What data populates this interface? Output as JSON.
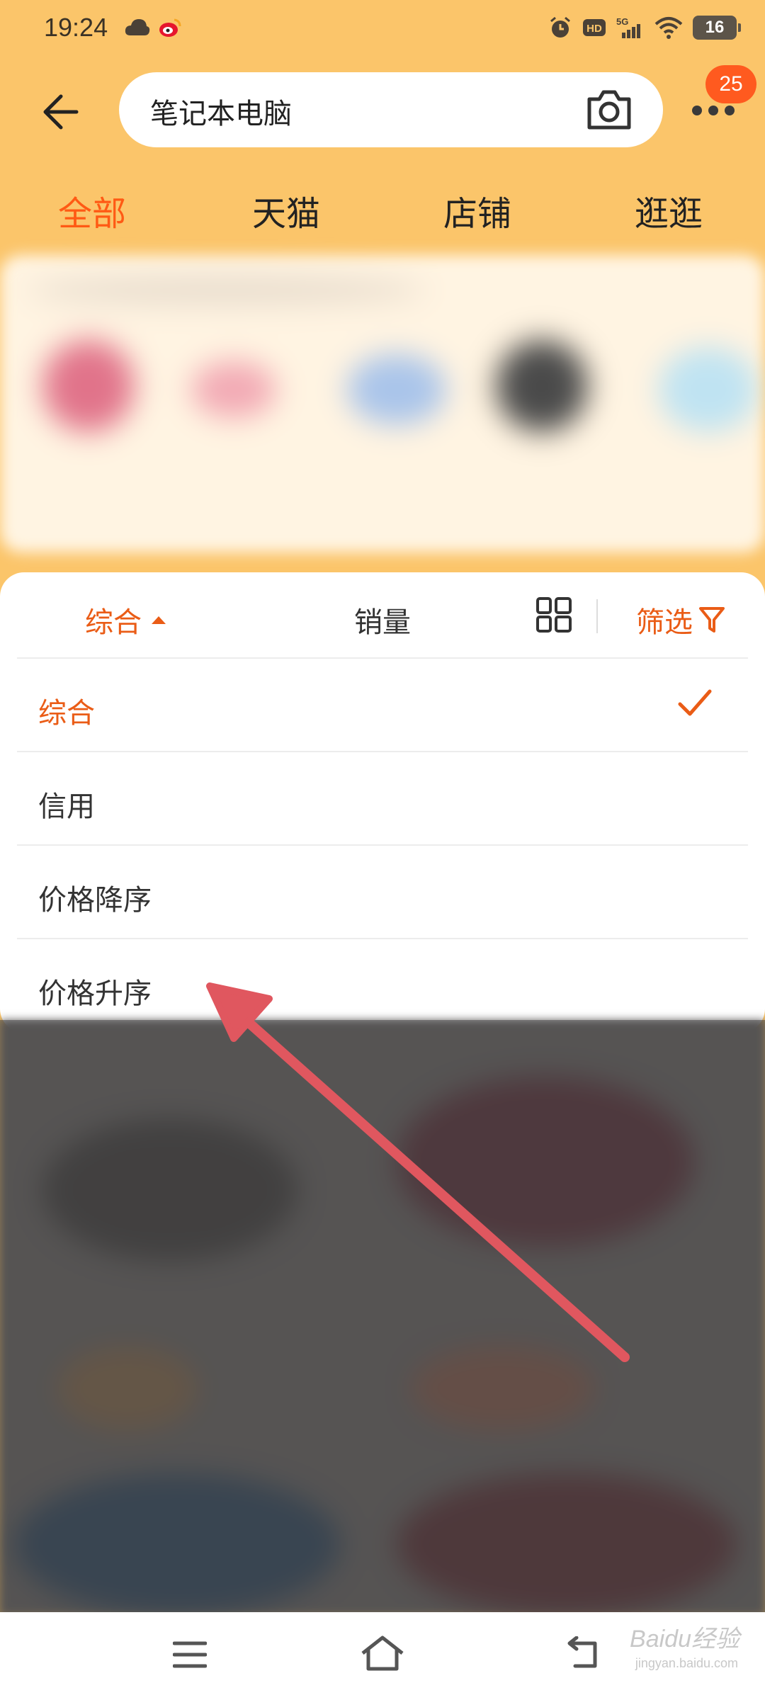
{
  "status_bar": {
    "time": "19:24",
    "battery": "16"
  },
  "header": {
    "search_query": "笔记本电脑",
    "notification_count": "25"
  },
  "tabs": [
    {
      "label": "全部",
      "active": true
    },
    {
      "label": "天猫",
      "active": false
    },
    {
      "label": "店铺",
      "active": false
    },
    {
      "label": "逛逛",
      "active": false
    }
  ],
  "sort_bar": {
    "comprehensive_label": "综合",
    "sales_label": "销量",
    "filter_label": "筛选"
  },
  "sort_options": [
    {
      "label": "综合",
      "selected": true
    },
    {
      "label": "信用",
      "selected": false
    },
    {
      "label": "价格降序",
      "selected": false
    },
    {
      "label": "价格升序",
      "selected": false
    }
  ],
  "watermark": {
    "main": "Baidu经验",
    "sub": "jingyan.baidu.com"
  },
  "colors": {
    "accent": "#ea5c16",
    "header_bg": "#fbc56a",
    "arrow": "#e0575f",
    "badge": "#ff5a1f"
  }
}
